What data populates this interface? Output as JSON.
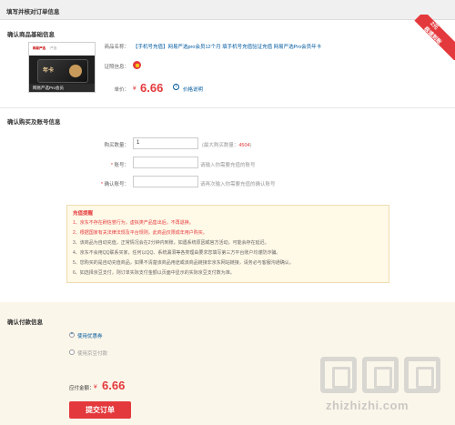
{
  "page": {
    "title": "填写并核对订单信息"
  },
  "product_section": {
    "title": "确认商品基础信息",
    "ribbon": {
      "line1": "2元",
      "line2": "极速到账"
    },
    "image": {
      "header_logo": "网易严选",
      "header_sub": "·严选·",
      "card_text": "年卡",
      "footer_text": "网易严选Pro会员"
    },
    "name_label": "商品名称：",
    "name_value": "【手机号充值】网易严选pro会员12个月 填手机号充值验证充值 网易严选Pro会员年卡",
    "cert_label": "证照信息：",
    "price_label": "单价：",
    "price_symbol": "¥",
    "price_value": "6.66",
    "price_note": "价格说明"
  },
  "account_section": {
    "title": "确认购买及账号信息",
    "quantity_label": "购买数量：",
    "quantity_value": "1",
    "quantity_max_prefix": "(最大购买数量：",
    "quantity_max_value": "4504",
    "quantity_max_suffix": ")",
    "account_label": "账号：",
    "account_placeholder": "",
    "account_hint": "请输入你需要充值的账号",
    "confirm_label": "确认账号：",
    "confirm_placeholder": "",
    "confirm_hint": "请再次输入你需要充值的确认账号",
    "required_mark": "*"
  },
  "notice": {
    "title": "充值提醒",
    "items": [
      "1、京东不存在刷信誉行为，虚拟类产品售出后，不再退换。",
      "2、根据国家有关法律法规及平台规则，此商品仅限成年用户购买。",
      "3、该商品为自动充值，正常情况会在2分钟内到账，如遇系统原因或官方活动，可能会存在延迟。",
      "4、京东不会用QQ联系买家，任何以QQ、系统漏洞等各类理由要求您填写第三方平台账户均谨防诈骗。",
      "5、您购买的是自动充值商品，如果不清楚该商品用途或该商品链接非京东网站链接，请务必与客服沟通确认。",
      "6、如选择京豆支付，则订单实际支付金额以页面中显示的实际京豆支付数为准。"
    ]
  },
  "payment_section": {
    "title": "确认付款信息",
    "coupon_label": "使用优惠券",
    "jingdou_label": "使用京豆付款",
    "amount_label": "应付金额：",
    "amount_symbol": "¥",
    "amount_value": "6.66",
    "submit_label": "提交订单"
  },
  "watermark": {
    "text": "zhizhizhi.com"
  },
  "colors": {
    "accent": "#e4393c",
    "link": "#005aa0",
    "notice_bg": "#fff9e8",
    "pay_bg": "#fbf6ea"
  }
}
